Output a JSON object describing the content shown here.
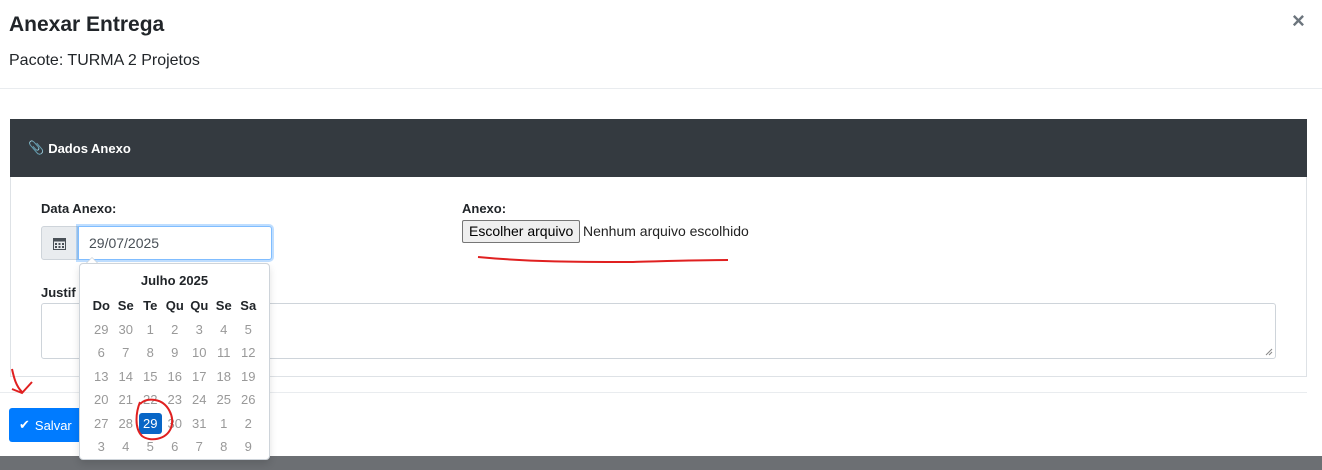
{
  "modal": {
    "title": "Anexar Entrega",
    "subtitle": "Pacote: TURMA 2 Projetos",
    "close_label": "×"
  },
  "card": {
    "header_title": "Dados Anexo"
  },
  "form": {
    "date_label": "Data Anexo:",
    "date_value": "29/07/2025",
    "attachment_label": "Anexo:",
    "file_button_label": "Escolher arquivo",
    "file_status": "Nenhum arquivo escolhido",
    "justification_label": "Justif"
  },
  "datepicker": {
    "title": "Julho 2025",
    "weekdays": [
      "Do",
      "Se",
      "Te",
      "Qu",
      "Qu",
      "Se",
      "Sa"
    ],
    "days": [
      "29",
      "30",
      "1",
      "2",
      "3",
      "4",
      "5",
      "6",
      "7",
      "8",
      "9",
      "10",
      "11",
      "12",
      "13",
      "14",
      "15",
      "16",
      "17",
      "18",
      "19",
      "20",
      "21",
      "22",
      "23",
      "24",
      "25",
      "26",
      "27",
      "28",
      "29",
      "30",
      "31",
      "1",
      "2",
      "3",
      "4",
      "5",
      "6",
      "7",
      "8",
      "9"
    ],
    "selected_index": 30
  },
  "footer": {
    "save_label": "Salvar"
  },
  "colors": {
    "primary": "#007bff",
    "header_dark": "#343a40",
    "selected_day": "#0866c6",
    "annotation_red": "#e02020"
  }
}
